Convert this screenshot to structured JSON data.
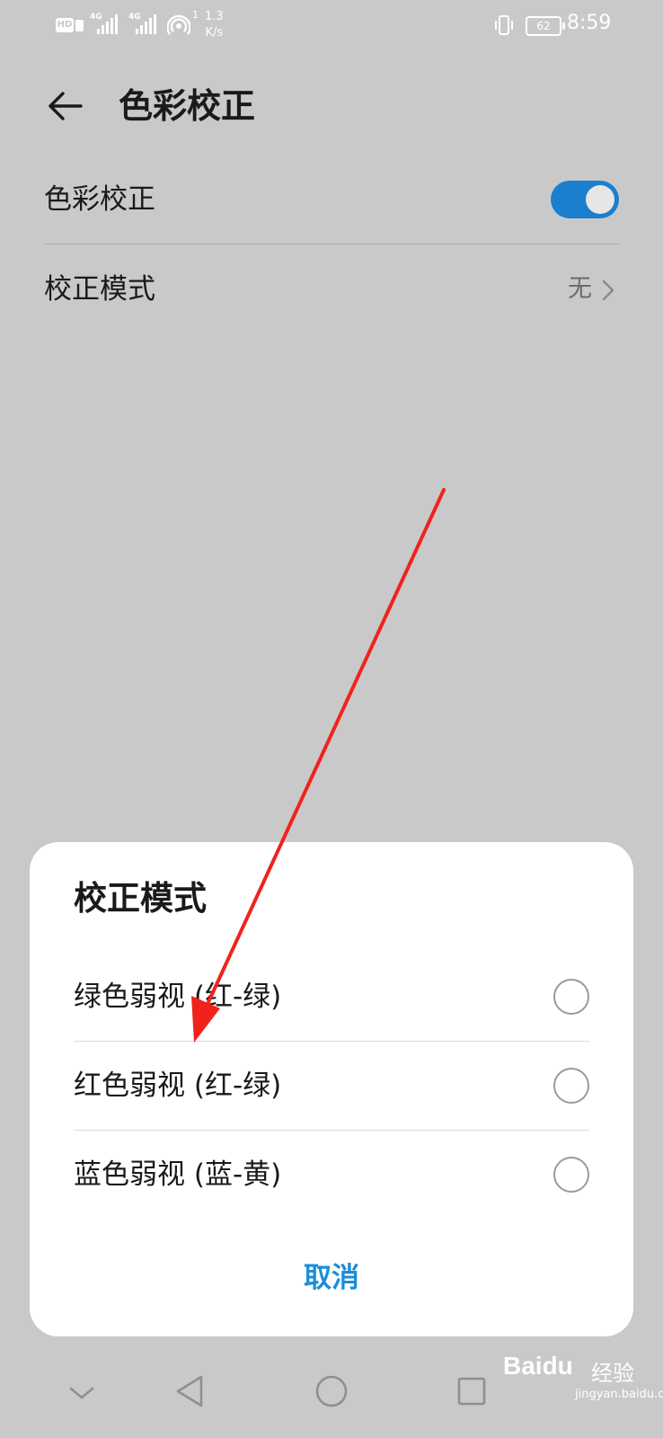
{
  "status_bar": {
    "hd_label": "HD",
    "signal1_label": "4G",
    "signal2_label": "4G",
    "hotspot_count": "1",
    "speed_value": "1.3",
    "speed_unit": "K/s",
    "battery": "62",
    "time": "8:59"
  },
  "header": {
    "title": "色彩校正"
  },
  "settings": {
    "color_correction_label": "色彩校正",
    "color_correction_on": true,
    "mode_label": "校正模式",
    "mode_value": "无"
  },
  "dialog": {
    "title": "校正模式",
    "options": [
      {
        "label": "绿色弱视 (红-绿)",
        "selected": false
      },
      {
        "label": "红色弱视 (红-绿)",
        "selected": false
      },
      {
        "label": "蓝色弱视 (蓝-黄)",
        "selected": false
      }
    ],
    "cancel_label": "取消"
  },
  "watermark": {
    "brand": "Baidu",
    "brand_cn": "经验",
    "url": "jingyan.baidu.com"
  },
  "colors": {
    "background": "#c9c9c9",
    "accent": "#1a7fcf",
    "cancel_text": "#1a8ed8",
    "annotation_arrow": "#f0231c"
  }
}
